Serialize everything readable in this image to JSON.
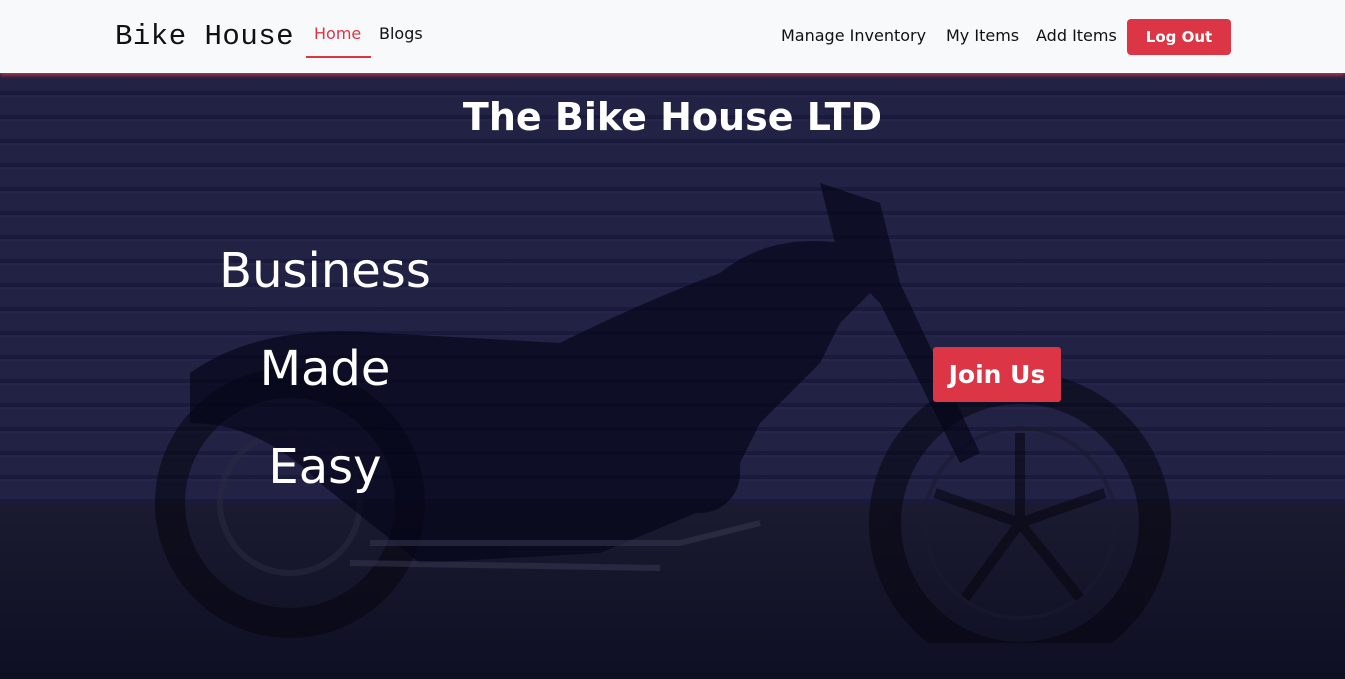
{
  "navbar": {
    "brand": "Bike House",
    "links": [
      {
        "label": "Home",
        "active": true
      },
      {
        "label": "Blogs",
        "active": false
      }
    ],
    "right_links": [
      {
        "label": "Manage Inventory"
      },
      {
        "label": "My Items"
      },
      {
        "label": "Add Items"
      }
    ],
    "logout_label": "Log Out"
  },
  "hero": {
    "title": "The Bike House LTD",
    "tagline": [
      "Business",
      "Made",
      "Easy"
    ],
    "cta_label": "Join Us"
  },
  "colors": {
    "accent": "#dc3545",
    "navbar_bg": "#f8f9fa",
    "overlay": "#12103a"
  }
}
